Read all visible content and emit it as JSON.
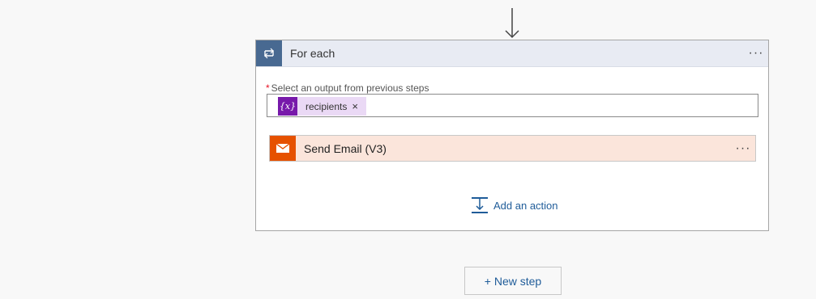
{
  "foreach": {
    "title": "For each",
    "menu_label": "···",
    "field_required_marker": "*",
    "field_label": "Select an output from previous steps",
    "token": {
      "icon_text": "{x}",
      "label": "recipients",
      "remove_label": "×"
    },
    "action": {
      "title": "Send Email (V3)",
      "menu_label": "···"
    },
    "add_action_label": "Add an action"
  },
  "new_step_label": "+ New step",
  "colors": {
    "loop_header_icon_bg": "#486991",
    "token_icon_bg": "#7719aa",
    "email_icon_bg": "#e65100",
    "link": "#1f5c99"
  }
}
